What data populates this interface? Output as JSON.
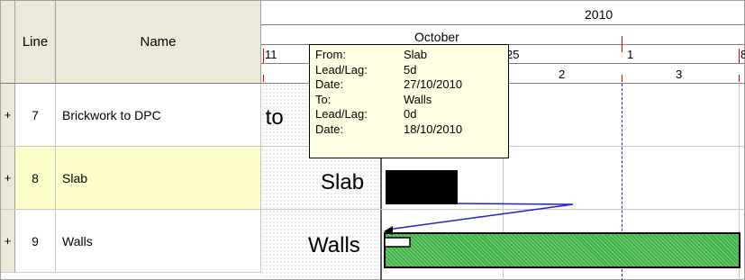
{
  "grid": {
    "headers": {
      "line": "Line",
      "name": "Name"
    },
    "rows": [
      {
        "marker": "+",
        "line": "7",
        "name": "Brickwork to DPC",
        "selected": false
      },
      {
        "marker": "+",
        "line": "8",
        "name": "Slab",
        "selected": true
      },
      {
        "marker": "+",
        "line": "9",
        "name": "Walls",
        "selected": false
      }
    ]
  },
  "gantt": {
    "year": "2010",
    "month": "October",
    "weeks": [
      "11",
      "25",
      "1",
      "8"
    ],
    "days": [
      "2",
      "3"
    ],
    "bar_labels": {
      "brickwork": "k to",
      "slab": "Slab",
      "walls": "Walls"
    }
  },
  "tooltip": {
    "rows": [
      {
        "key": "From:",
        "value": "Slab"
      },
      {
        "key": "Lead/Lag:",
        "value": "5d"
      },
      {
        "key": "Date:",
        "value": "27/10/2010"
      },
      {
        "key": "To:",
        "value": "Walls"
      },
      {
        "key": "Lead/Lag:",
        "value": "0d"
      },
      {
        "key": "Date:",
        "value": "18/10/2010"
      }
    ]
  },
  "colors": {
    "header_bg": "#ece9d8",
    "selected_row": "#ffffcc",
    "tooltip_bg": "#ffffe1",
    "walls_bar": "#3cb043",
    "slab_bar": "#000000",
    "link_line": "#2020d0",
    "tick": "#e00000"
  }
}
